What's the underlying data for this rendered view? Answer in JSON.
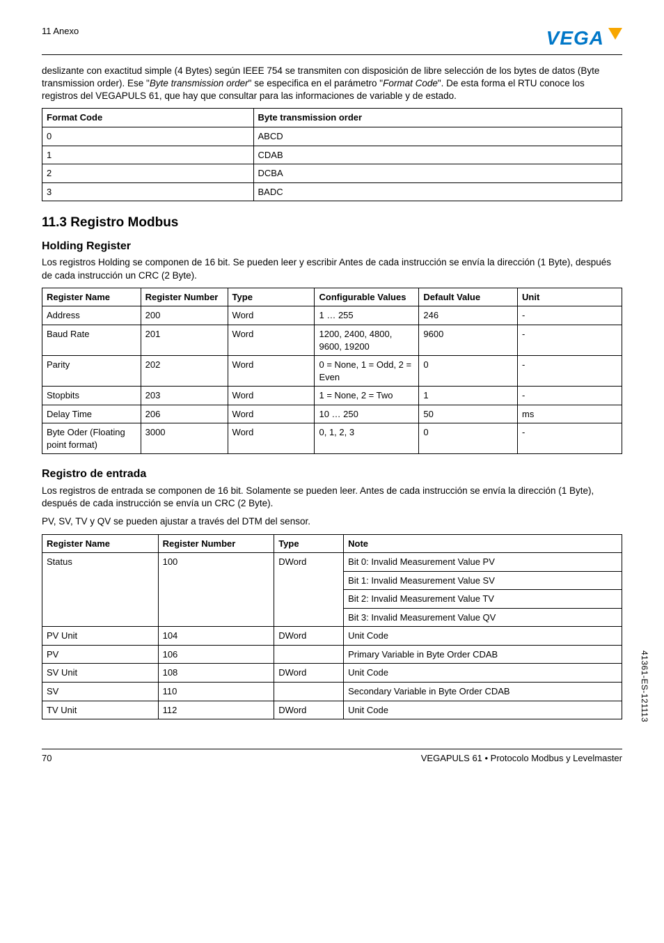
{
  "header": {
    "section": "11 Anexo",
    "brand": "VEGA"
  },
  "intro_text": "deslizante con exactitud simple (4 Bytes) según IEEE 754 se transmiten con disposición de libre selección de los bytes de datos (Byte transmission order). Ese \"Byte transmission order\" se especifica en el parámetro \"Format Code\". De esta forma el RTU conoce los registros del VEGAPULS 61, que hay que consultar para las informaciones de variable y de estado.",
  "format_table": {
    "headers": [
      "Format Code",
      "Byte transmission order"
    ],
    "rows": [
      [
        "0",
        "ABCD"
      ],
      [
        "1",
        "CDAB"
      ],
      [
        "2",
        "DCBA"
      ],
      [
        "3",
        "BADC"
      ]
    ]
  },
  "section_11_3": {
    "title": "11.3   Registro Modbus",
    "holding": {
      "heading": "Holding Register",
      "text": "Los registros Holding se componen de 16 bit. Se pueden leer y escribir Antes de cada instrucción se envía la dirección (1 Byte), después de cada instrucción un CRC (2 Byte).",
      "table": {
        "headers": [
          "Register Name",
          "Register Number",
          "Type",
          "Configurable Values",
          "Default Value",
          "Unit"
        ],
        "rows": [
          [
            "Address",
            "200",
            "Word",
            "1 … 255",
            "246",
            "-"
          ],
          [
            "Baud Rate",
            "201",
            "Word",
            "1200, 2400, 4800, 9600, 19200",
            "9600",
            "-"
          ],
          [
            "Parity",
            "202",
            "Word",
            "0 = None, 1 = Odd, 2 = Even",
            "0",
            "-"
          ],
          [
            "Stopbits",
            "203",
            "Word",
            "1 = None, 2 = Two",
            "1",
            "-"
          ],
          [
            "Delay Time",
            "206",
            "Word",
            "10 … 250",
            "50",
            "ms"
          ],
          [
            "Byte Oder (Floating point format)",
            "3000",
            "Word",
            "0, 1, 2, 3",
            "0",
            "-"
          ]
        ]
      }
    },
    "input": {
      "heading": "Registro de entrada",
      "text1": "Los registros de entrada se componen de 16 bit. Solamente se pueden leer. Antes de cada instrucción se envía la dirección (1 Byte), después de cada instrucción se envía un CRC (2 Byte).",
      "text2": "PV, SV, TV y QV se pueden ajustar a través del DTM del sensor.",
      "table": {
        "headers": [
          "Register Name",
          "Register Number",
          "Type",
          "Note"
        ],
        "rows": [
          {
            "name": "Status",
            "num": "100",
            "type": "DWord",
            "notes": [
              "Bit 0: Invalid Measurement Value PV",
              "Bit 1: Invalid Measurement Value SV",
              "Bit 2: Invalid Measurement Value TV",
              "Bit 3: Invalid Measurement Value QV"
            ]
          },
          {
            "name": "PV Unit",
            "num": "104",
            "type": "DWord",
            "notes": [
              "Unit Code"
            ]
          },
          {
            "name": "PV",
            "num": "106",
            "type": "",
            "notes": [
              "Primary Variable in Byte Order CDAB"
            ]
          },
          {
            "name": "SV Unit",
            "num": "108",
            "type": "DWord",
            "notes": [
              "Unit Code"
            ]
          },
          {
            "name": "SV",
            "num": "110",
            "type": "",
            "notes": [
              "Secondary Variable in Byte Order CDAB"
            ]
          },
          {
            "name": "TV Unit",
            "num": "112",
            "type": "DWord",
            "notes": [
              "Unit Code"
            ]
          }
        ]
      }
    }
  },
  "footer": {
    "page": "70",
    "doc": "VEGAPULS 61 • Protocolo Modbus y Levelmaster"
  },
  "side": "41361-ES-121113"
}
